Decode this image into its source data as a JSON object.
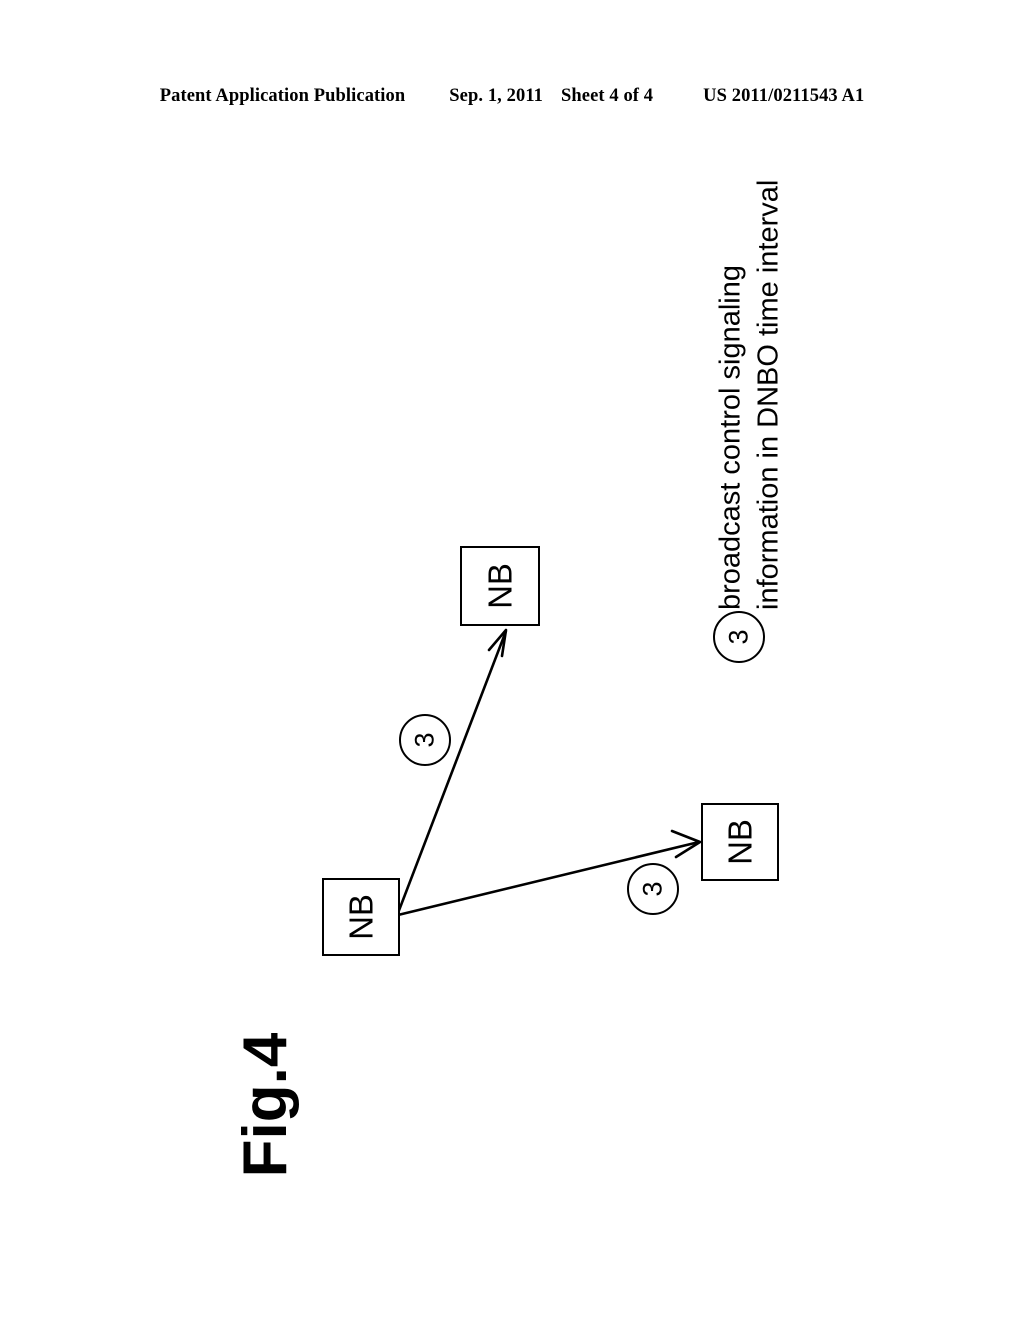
{
  "header": {
    "publication": "Patent Application Publication",
    "date": "Sep. 1, 2011",
    "sheet": "Sheet 4 of 4",
    "patent_number": "US 2011/0211543 A1"
  },
  "figure": {
    "label": "Fig.4",
    "nodes": [
      {
        "id": "nb-top",
        "label": "NB"
      },
      {
        "id": "nb-source",
        "label": "NB"
      },
      {
        "id": "nb-right",
        "label": "NB"
      }
    ],
    "reference_numerals": [
      {
        "id": "ref-upper",
        "value": "3"
      },
      {
        "id": "ref-lower",
        "value": "3"
      },
      {
        "id": "ref-legend",
        "value": "3"
      }
    ],
    "legend": {
      "numeral": "3",
      "line1": "broadcast control signaling",
      "line2": "information in DNBO time interval",
      "full_text": "broadcast control signaling information in DNBO time interval"
    },
    "arrows": [
      {
        "id": "arrow-to-top",
        "from": "nb-source",
        "to": "nb-top",
        "numeral": "3"
      },
      {
        "id": "arrow-to-right",
        "from": "nb-source",
        "to": "nb-right",
        "numeral": "3"
      }
    ],
    "colors": {
      "ink": "#000000",
      "paper": "#ffffff"
    }
  }
}
